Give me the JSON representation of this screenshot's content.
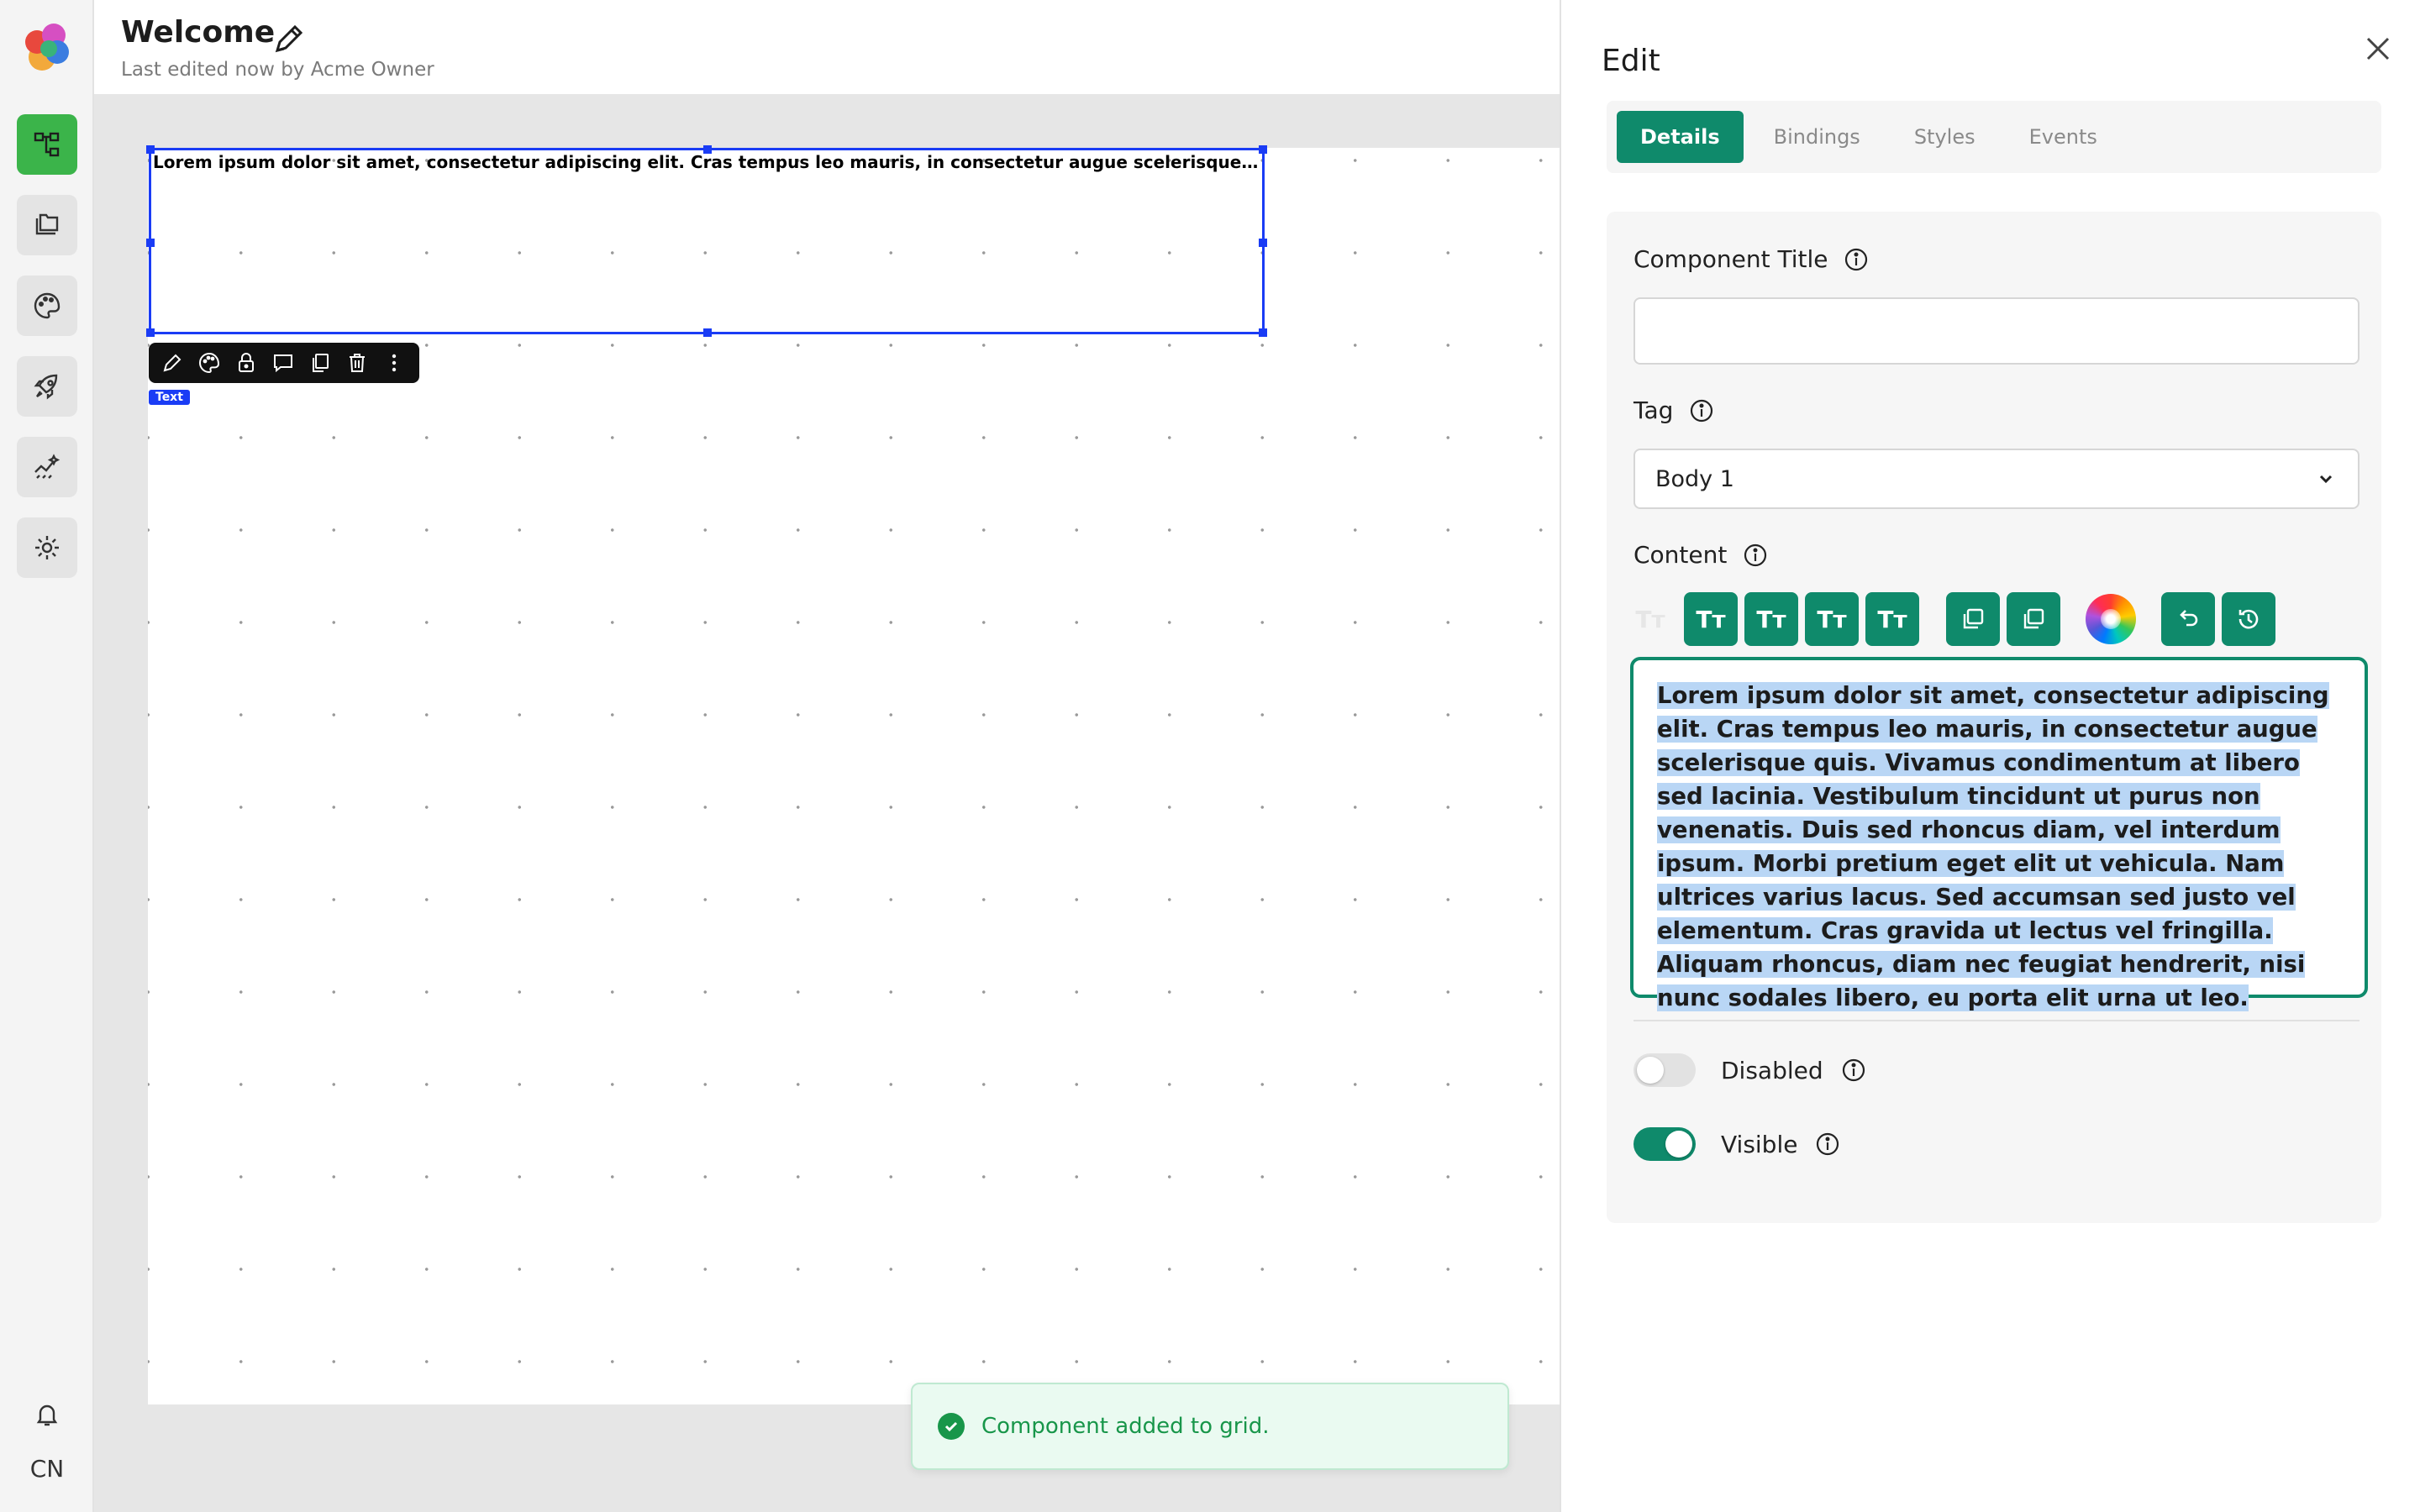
{
  "header": {
    "title": "Welcome",
    "subtitle": "Last edited now by Acme Owner"
  },
  "rail": {
    "items": [
      {
        "icon": "tree-icon",
        "active": true
      },
      {
        "icon": "folders-icon",
        "active": false
      },
      {
        "icon": "palette-icon",
        "active": false
      },
      {
        "icon": "rocket-icon",
        "active": false
      },
      {
        "icon": "analytics-icon",
        "active": false
      },
      {
        "icon": "gear-icon",
        "active": false
      }
    ],
    "avatar": "CN"
  },
  "canvas": {
    "selected_text": "Lorem ipsum dolor sit amet, consectetur adipiscing elit. Cras tempus leo mauris, in consectetur augue scelerisque quis. Vivamus condimentum at libero sed lacinia. Vestibulum tincidunt ut purus non venenatis.",
    "type_tag": "Text",
    "toast": "Component added to grid."
  },
  "panel": {
    "title": "Edit",
    "tabs": [
      {
        "label": "Details",
        "active": true
      },
      {
        "label": "Bindings",
        "active": false
      },
      {
        "label": "Styles",
        "active": false
      },
      {
        "label": "Events",
        "active": false
      }
    ],
    "component_title_label": "Component Title",
    "component_title_value": "",
    "tag_label": "Tag",
    "tag_value": "Body 1",
    "content_label": "Content",
    "format_glyph": "Tт",
    "content_text": "Lorem ipsum dolor sit amet, consectetur adipiscing elit. Cras tempus leo mauris, in consectetur augue scelerisque quis. Vivamus condimentum at libero sed lacinia. Vestibulum tincidunt ut purus non venenatis. Duis sed rhoncus diam, vel interdum ipsum. Morbi pretium eget elit ut vehicula. Nam ultrices varius lacus. Sed accumsan sed justo vel elementum. Cras gravida ut lectus vel fringilla. Aliquam rhoncus, diam nec feugiat hendrerit, nisi nunc sodales libero, eu porta elit urna ut leo.",
    "disabled_label": "Disabled",
    "disabled": false,
    "visible_label": "Visible",
    "visible": true
  },
  "colors": {
    "accent": "#0f8a6b",
    "selection": "#1a3cf5",
    "rail_active": "#3bb44a",
    "toast_text": "#18964a"
  }
}
